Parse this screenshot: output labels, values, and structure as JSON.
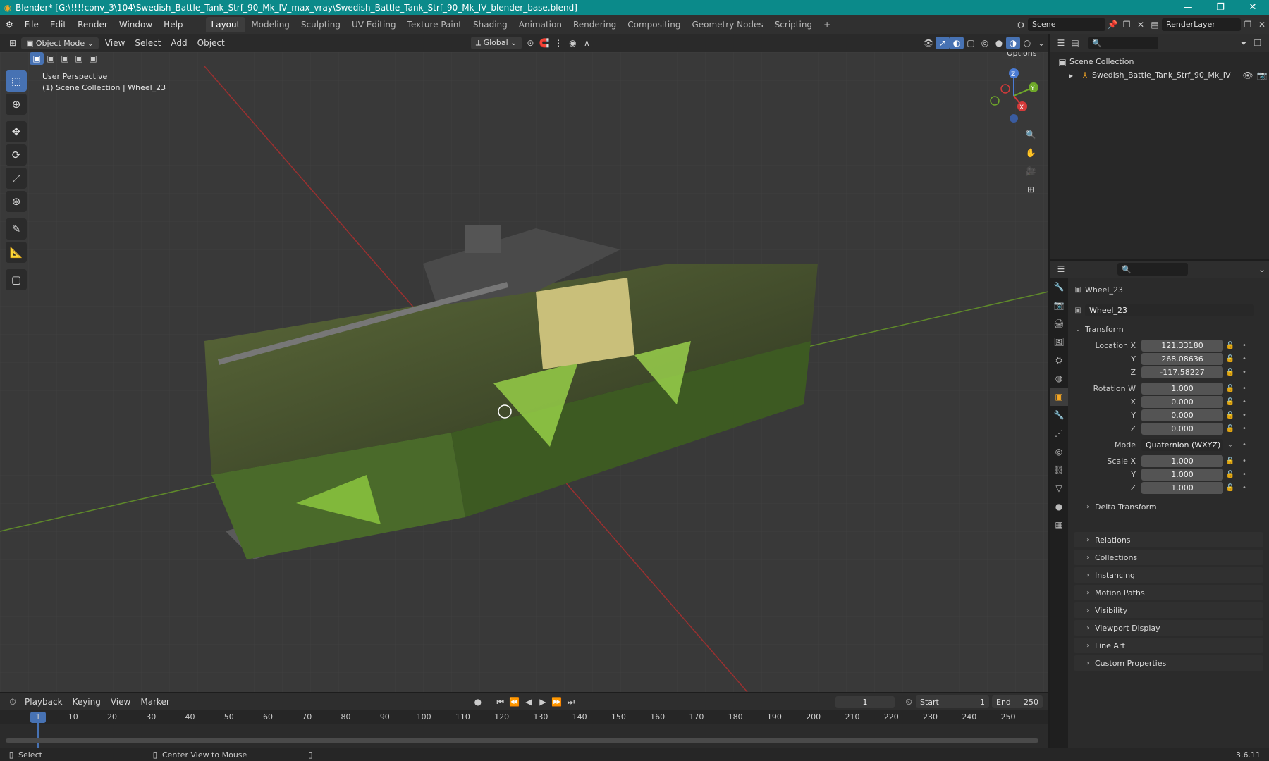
{
  "window": {
    "title": "Blender* [G:\\!!!!conv_3\\104\\Swedish_Battle_Tank_Strf_90_Mk_IV_max_vray\\Swedish_Battle_Tank_Strf_90_Mk_IV_blender_base.blend]",
    "minimize": "—",
    "maximize": "❐",
    "close": "✕"
  },
  "menu": [
    "File",
    "Edit",
    "Render",
    "Window",
    "Help"
  ],
  "workspaces": [
    "Layout",
    "Modeling",
    "Sculpting",
    "UV Editing",
    "Texture Paint",
    "Shading",
    "Animation",
    "Rendering",
    "Compositing",
    "Geometry Nodes",
    "Scripting"
  ],
  "workspace_add": "+",
  "scene": {
    "name": "Scene",
    "render_layer": "RenderLayer"
  },
  "viewport_header": {
    "mode": "Object Mode",
    "menus": [
      "View",
      "Select",
      "Add",
      "Object"
    ],
    "transform_orientation": "Global",
    "options": "Options"
  },
  "viewport": {
    "perspective": "User Perspective",
    "collection_info": "(1) Scene Collection | Wheel_23",
    "gizmo_axes": {
      "x": "X",
      "y": "Y",
      "z": "Z"
    }
  },
  "outliner": {
    "root": "Scene Collection",
    "items": [
      "Swedish_Battle_Tank_Strf_90_Mk_IV"
    ]
  },
  "properties": {
    "object_name": "Wheel_23",
    "data_name": "Wheel_23",
    "transform_header": "Transform",
    "location": {
      "label": "Location X",
      "x": "121.33180",
      "y": "268.08636",
      "z": "-117.58227"
    },
    "rotation": {
      "label": "Rotation W",
      "w": "1.000",
      "x": "0.000",
      "y": "0.000",
      "z": "0.000"
    },
    "mode_label": "Mode",
    "mode": "Quaternion (WXYZ)",
    "scale": {
      "label": "Scale X",
      "x": "1.000",
      "y": "1.000",
      "z": "1.000"
    },
    "axis_labels": {
      "x": "X",
      "y": "Y",
      "z": "Z"
    },
    "delta_transform": "Delta Transform",
    "panels": [
      "Relations",
      "Collections",
      "Instancing",
      "Motion Paths",
      "Visibility",
      "Viewport Display",
      "Line Art",
      "Custom Properties"
    ]
  },
  "timeline": {
    "menus": [
      "Playback",
      "Keying",
      "View",
      "Marker"
    ],
    "current_frame": "1",
    "start_label": "Start",
    "start": "1",
    "end_label": "End",
    "end": "250",
    "ticks": [
      "1",
      "10",
      "20",
      "30",
      "40",
      "50",
      "60",
      "70",
      "80",
      "90",
      "100",
      "110",
      "120",
      "130",
      "140",
      "150",
      "160",
      "170",
      "180",
      "190",
      "200",
      "210",
      "220",
      "230",
      "240",
      "250"
    ]
  },
  "status": {
    "select": "Select",
    "center_view": "Center View to Mouse",
    "version": "3.6.11"
  },
  "colors": {
    "accent": "#4772b3",
    "titlebar": "#0b8a8a",
    "object_orange": "#f5a623"
  }
}
